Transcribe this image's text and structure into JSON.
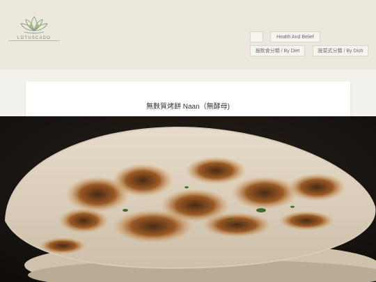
{
  "brand": {
    "name": "LOTUSCADO"
  },
  "nav": {
    "blank_label": "",
    "health_label": "Health And Belief",
    "diet_label": "按飲食分類 / By Diet",
    "dish_label": "按菜式分類 / By Dish"
  },
  "post": {
    "title": "無麩質烤餅 Naan（無酵母)"
  },
  "hero": {
    "icon": "naan-bread-photo"
  },
  "colors": {
    "header_bg": "#ece8dd",
    "page_bg": "#f3f1ec",
    "accent": "#6d8a77"
  }
}
